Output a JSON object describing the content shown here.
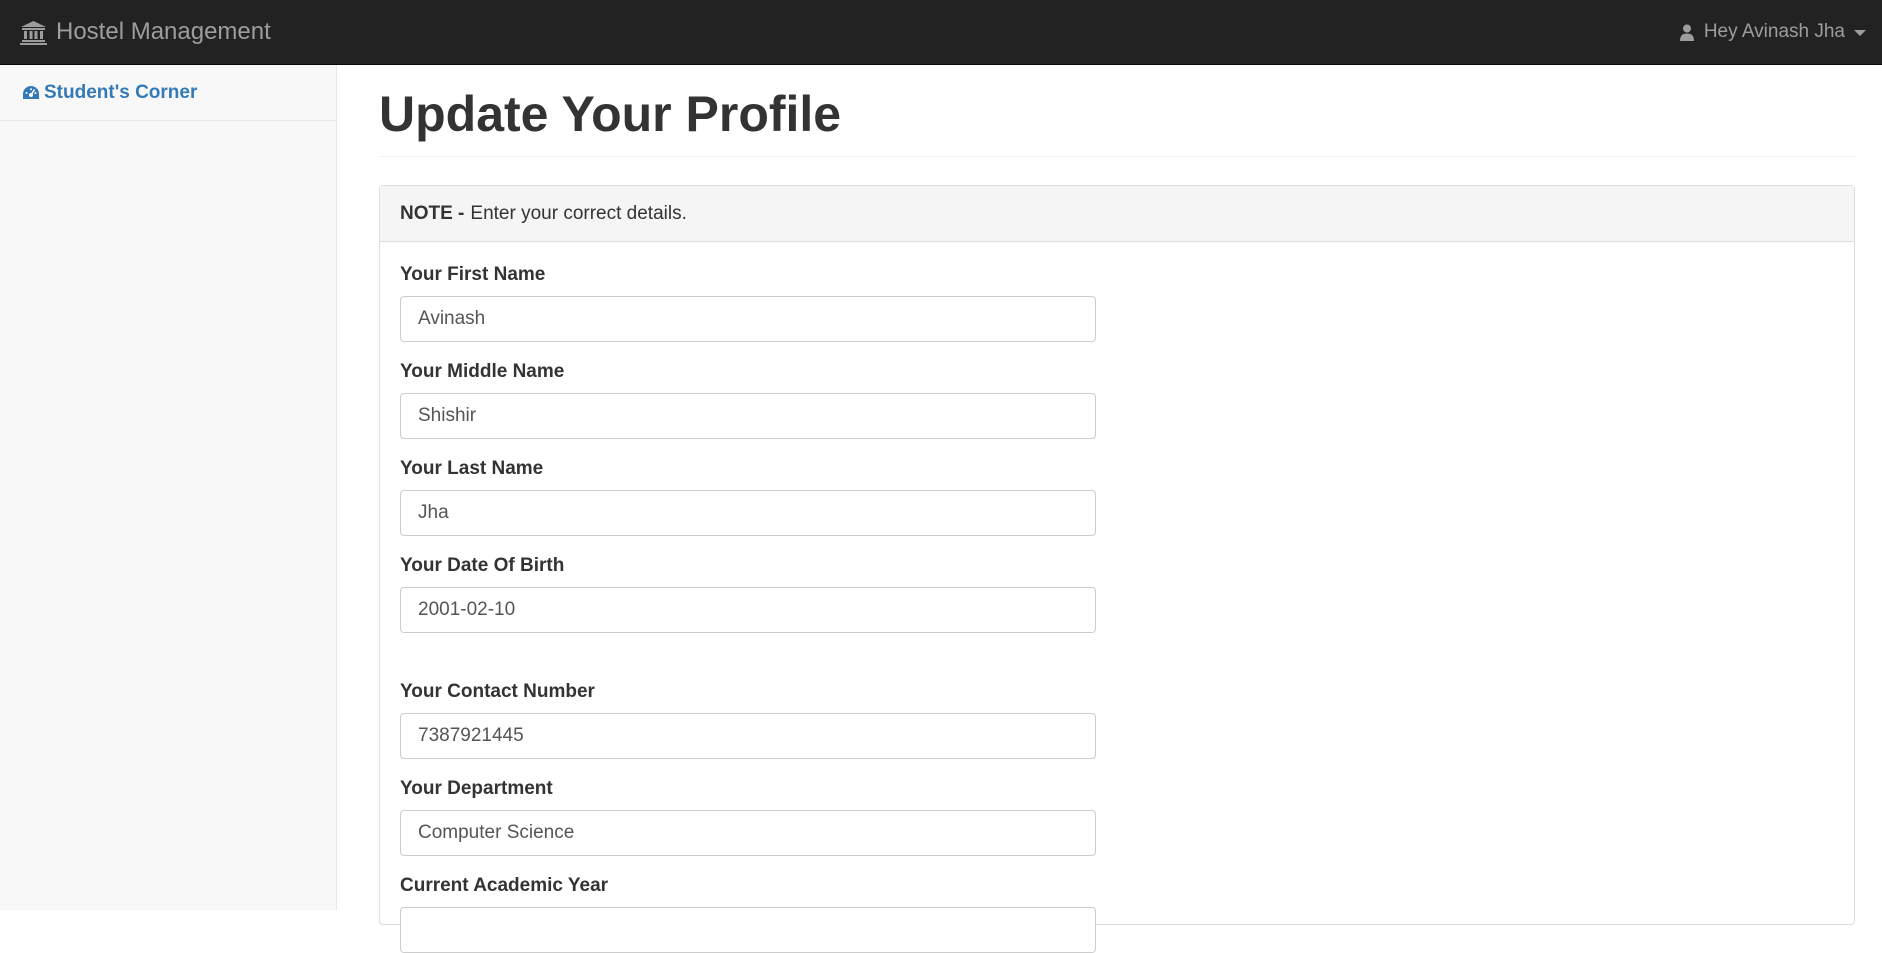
{
  "navbar": {
    "brand_icon": "institution-icon",
    "brand": "Hostel Management",
    "user_icon": "user-icon",
    "user_label": "Hey Avinash Jha"
  },
  "sidebar": {
    "items": [
      {
        "icon": "dashboard-icon",
        "label": "Student's Corner"
      }
    ]
  },
  "main": {
    "title": "Update Your Profile",
    "note": {
      "strong": "NOTE -",
      "text": "Enter your correct details."
    },
    "fields": [
      {
        "label": "Your First Name",
        "value": "Avinash"
      },
      {
        "label": "Your Middle Name",
        "value": "Shishir"
      },
      {
        "label": "Your Last Name",
        "value": "Jha"
      },
      {
        "label": "Your Date Of Birth",
        "value": "2001-02-10"
      },
      {
        "label": "Your Contact Number",
        "value": "7387921445"
      },
      {
        "label": "Your Department",
        "value": "Computer Science"
      },
      {
        "label": "Current Academic Year",
        "value": ""
      }
    ]
  },
  "colors": {
    "navbar_bg": "#222222",
    "navbar_text": "#9d9d9d",
    "link": "#337ab7",
    "sidebar_bg": "#f8f8f8"
  }
}
